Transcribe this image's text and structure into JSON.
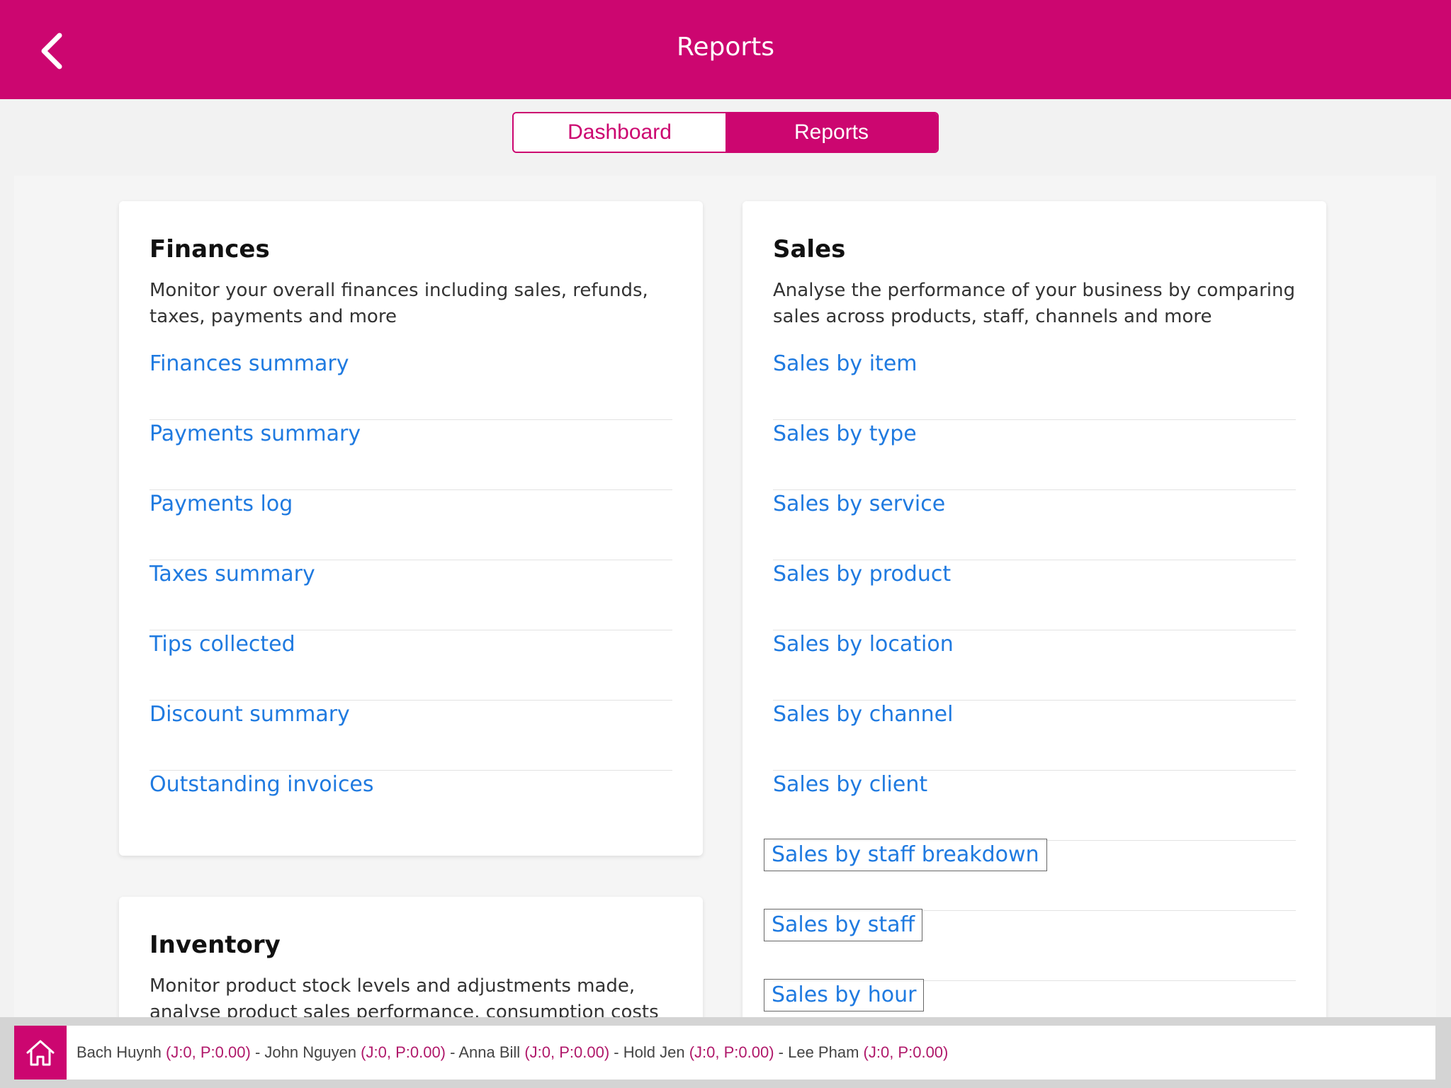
{
  "header": {
    "title": "Reports",
    "back_icon": "chevron-left-icon"
  },
  "tabs": [
    {
      "label": "Dashboard",
      "active": false
    },
    {
      "label": "Reports",
      "active": true
    }
  ],
  "finances": {
    "title": "Finances",
    "description": "Monitor your overall finances including sales, refunds, taxes, payments and more",
    "links": [
      "Finances summary",
      "Payments summary",
      "Payments log",
      "Taxes summary",
      "Tips collected",
      "Discount summary",
      "Outstanding invoices"
    ]
  },
  "sales": {
    "title": "Sales",
    "description": "Analyse the performance of your business by comparing sales across products, staff, channels and more",
    "links": [
      "Sales by item",
      "Sales by type",
      "Sales by service",
      "Sales by product",
      "Sales by location",
      "Sales by channel",
      "Sales by client",
      "Sales by staff breakdown",
      "Sales by staff",
      "Sales by hour"
    ]
  },
  "inventory": {
    "title": "Inventory",
    "description": "Monitor product stock levels and adjustments made, analyse product sales performance, consumption costs"
  },
  "footer": {
    "home_icon": "home-icon",
    "staff": [
      {
        "name": "Bach Huynh",
        "stats": "(J:0, P:0.00)"
      },
      {
        "name": "John Nguyen",
        "stats": "(J:0, P:0.00)"
      },
      {
        "name": "Anna Bill",
        "stats": "(J:0, P:0.00)"
      },
      {
        "name": "Hold Jen",
        "stats": "(J:0, P:0.00)"
      },
      {
        "name": "Lee Pham",
        "stats": "(J:0, P:0.00)"
      }
    ],
    "separator": " - "
  },
  "colors": {
    "brand": "#cc0670",
    "link": "#1f7ae0"
  }
}
